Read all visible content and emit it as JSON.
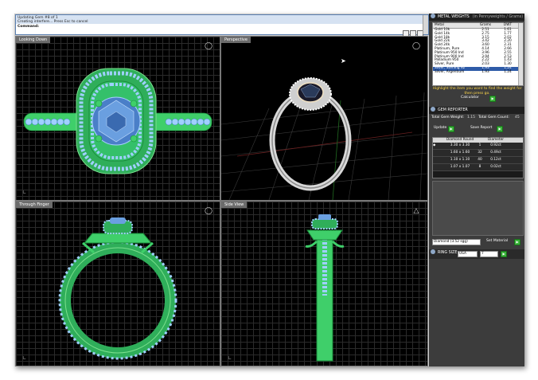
{
  "command": {
    "line1": "Updating Gem #8 of 1",
    "line2": "Creating interfere... Press Esc to cancel",
    "prompt": "Command:"
  },
  "viewports": {
    "top": "Looking Down",
    "perspective": "Perspective",
    "front": "Through Finger",
    "right": "Side View"
  },
  "metal_weights": {
    "title": "METAL WEIGHTS",
    "subtitle": "(in Pennyweights / Grams)",
    "headers": [
      "Metal",
      "Grams",
      "DWT"
    ],
    "rows": [
      [
        "Gold 10k",
        "2.51",
        "1.61"
      ],
      [
        "Gold 14k",
        "2.75",
        "1.77"
      ],
      [
        "Gold 18k",
        "3.15",
        "2.02"
      ],
      [
        "Gold 22k",
        "3.42",
        "2.20"
      ],
      [
        "Gold 24k",
        "3.60",
        "2.31"
      ],
      [
        "Platinum, Pure",
        "4.14",
        "2.66"
      ],
      [
        "Platinum 950 Ind",
        "3.96",
        "2.55"
      ],
      [
        "Platinum 900 Ind",
        "3.94",
        "2.53"
      ],
      [
        "Palladium 950",
        "2.22",
        "1.43"
      ],
      [
        "Silver, Pure",
        "2.03",
        "1.30"
      ],
      [
        "Silver, Sterling 92",
        "1.93",
        "1.24"
      ],
      [
        "Silver, Argentium",
        "1.93",
        "1.24"
      ]
    ],
    "hint": "Highlight the item you want to find the weight for then press go.",
    "calculator_label": "Calculator",
    "go_label": "▶"
  },
  "gem_reporter": {
    "title": "GEM REPORTER",
    "total_weight_label": "Total Gem Weight:",
    "total_weight_value": "1.15",
    "total_count_label": "Total Gem Count:",
    "total_count_value": "45",
    "update_label": "Update",
    "save_label": "Save Report",
    "headers": [
      "",
      "Diamond Round",
      "Diameter",
      ""
    ],
    "rows": [
      [
        "3.30 x 3.30",
        "1",
        "0.92ct"
      ],
      [
        "1.60 x 1.60",
        "32",
        "0.49ct"
      ],
      [
        "1.10 x 1.10",
        "40",
        "0.12ct"
      ],
      [
        "1.07 x 1.07",
        "8",
        "0.02ct"
      ]
    ]
  },
  "material": {
    "select_value": "Diamond  (3.52 sgg)",
    "set_label": "Set Material"
  },
  "ring_size": {
    "label": "RING SIZE",
    "unit": "USA",
    "value": "7"
  },
  "colors": {
    "accent": "#3bb43b",
    "panel_bg": "#3c3c3c",
    "model_green": "#4bd84b",
    "gem_blue": "#7fb6f0"
  }
}
